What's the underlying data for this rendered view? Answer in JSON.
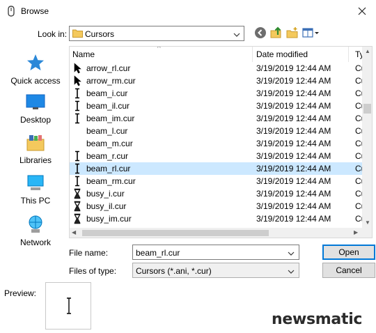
{
  "window": {
    "title": "Browse"
  },
  "toolbar": {
    "look_in_label": "Look in:",
    "look_in_value": "Cursors"
  },
  "places": [
    "Quick access",
    "Desktop",
    "Libraries",
    "This PC",
    "Network"
  ],
  "columns": {
    "name": "Name",
    "date": "Date modified",
    "type": "Ty"
  },
  "files": [
    {
      "name": "arrow_rl.cur",
      "date": "3/19/2019 12:44 AM",
      "type": "Cu",
      "icon": "arrow-cursor-icon"
    },
    {
      "name": "arrow_rm.cur",
      "date": "3/19/2019 12:44 AM",
      "type": "Cu",
      "icon": "arrow-cursor-icon"
    },
    {
      "name": "beam_i.cur",
      "date": "3/19/2019 12:44 AM",
      "type": "Cu",
      "icon": "ibeam-cursor-icon"
    },
    {
      "name": "beam_il.cur",
      "date": "3/19/2019 12:44 AM",
      "type": "Cu",
      "icon": "ibeam-cursor-icon"
    },
    {
      "name": "beam_im.cur",
      "date": "3/19/2019 12:44 AM",
      "type": "Cu",
      "icon": "ibeam-cursor-icon"
    },
    {
      "name": "beam_l.cur",
      "date": "3/19/2019 12:44 AM",
      "type": "Cu",
      "icon": ""
    },
    {
      "name": "beam_m.cur",
      "date": "3/19/2019 12:44 AM",
      "type": "Cu",
      "icon": ""
    },
    {
      "name": "beam_r.cur",
      "date": "3/19/2019 12:44 AM",
      "type": "Cu",
      "icon": "ibeam-cursor-icon"
    },
    {
      "name": "beam_rl.cur",
      "date": "3/19/2019 12:44 AM",
      "type": "Cu",
      "icon": "ibeam-cursor-icon",
      "selected": true
    },
    {
      "name": "beam_rm.cur",
      "date": "3/19/2019 12:44 AM",
      "type": "Cu",
      "icon": "ibeam-cursor-icon"
    },
    {
      "name": "busy_i.cur",
      "date": "3/19/2019 12:44 AM",
      "type": "Cu",
      "icon": "hourglass-cursor-icon"
    },
    {
      "name": "busy_il.cur",
      "date": "3/19/2019 12:44 AM",
      "type": "Cu",
      "icon": "hourglass-cursor-icon"
    },
    {
      "name": "busy_im.cur",
      "date": "3/19/2019 12:44 AM",
      "type": "Cu",
      "icon": "hourglass-cursor-icon"
    }
  ],
  "form": {
    "file_name_label": "File name:",
    "file_name_value": "beam_rl.cur",
    "file_type_label": "Files of type:",
    "file_type_value": "Cursors (*.ani, *.cur)"
  },
  "buttons": {
    "open": "Open",
    "cancel": "Cancel"
  },
  "preview": {
    "label": "Preview:"
  },
  "watermark": "newsmatic",
  "colors": {
    "selection": "#cce8ff",
    "accent": "#0078d7"
  }
}
